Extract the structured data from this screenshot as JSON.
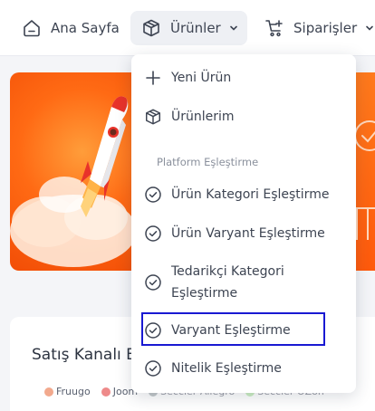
{
  "nav": {
    "home_label": "Ana Sayfa",
    "products_label": "Ürünler",
    "orders_label": "Siparişler",
    "icons": {
      "home": "home-icon",
      "products": "box-icon",
      "orders": "cart-plus-icon",
      "caret": "chevron-down-icon"
    }
  },
  "dropdown": {
    "items": [
      {
        "label": "Yeni Ürün",
        "icon": "plus-icon"
      },
      {
        "label": "Ürünlerim",
        "icon": "box-icon"
      }
    ],
    "section_label": "Platform Eşleştirme",
    "platform_items": [
      {
        "label": "Ürün Kategori Eşleştirme",
        "icon": "check-circle-icon"
      },
      {
        "label": "Ürün Varyant Eşleştirme",
        "icon": "check-circle-icon"
      },
      {
        "label": "Tedarikçi Kategori Eşleştirme",
        "icon": "check-circle-icon"
      },
      {
        "label": "Varyant Eşleştirme",
        "icon": "check-circle-icon",
        "selected": true
      },
      {
        "label": "Nitelik Eşleştirme",
        "icon": "check-circle-icon"
      }
    ]
  },
  "sales_card": {
    "title": "Satış Kanalı B",
    "legend": [
      {
        "label": "Fruugo",
        "color": "#f2a98d"
      },
      {
        "label": "Joom",
        "color": "#ee8a8a"
      },
      {
        "label": "Seccler Allegro",
        "color": "#9aa4a8"
      },
      {
        "label": "Seccler OZon",
        "color": "#a9e59a"
      }
    ]
  },
  "colors": {
    "accent_orange": "#ff6a14",
    "selection_outline": "#1919d2",
    "active_nav_bg": "#eef0f4"
  }
}
